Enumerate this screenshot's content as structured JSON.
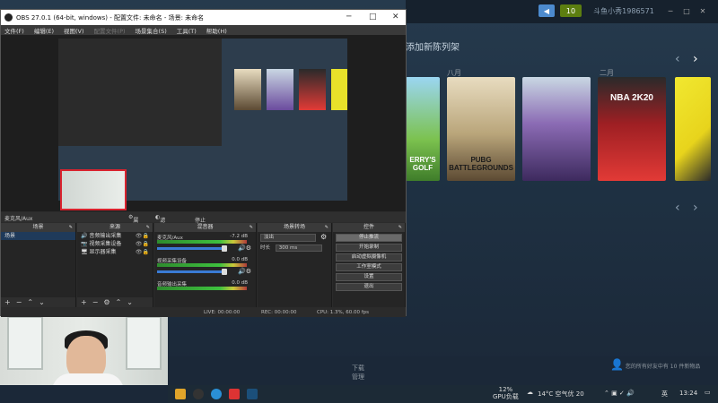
{
  "obs": {
    "title": "OBS 27.0.1 (64-bit, windows) - 配置文件: 未命名 - 场景: 未命名",
    "menu": [
      "文件(F)",
      "编辑(E)",
      "视图(V)",
      "配置文件(P)",
      "场景集合(S)",
      "工具(T)",
      "帮助(H)"
    ],
    "toolbar": {
      "source_label": "麦克风/Aux",
      "properties": "属性",
      "filters": "滤镜",
      "deactivate": "停止激活"
    },
    "docks": {
      "scenes": {
        "title": "场景",
        "items": [
          "场景"
        ]
      },
      "sources": {
        "title": "来源",
        "items": [
          "音频输出采集",
          "视频采集设备",
          "显示器采集"
        ]
      },
      "mixer": {
        "title": "混音器",
        "channels": [
          {
            "name": "麦克风/Aux",
            "db": "-7.2 dB",
            "level": 0.7
          },
          {
            "name": "视频采集设备",
            "db": "0.0 dB",
            "level": 0.7
          },
          {
            "name": "音频输出采集",
            "db": "0.0 dB",
            "level": 0.7
          }
        ]
      },
      "transitions": {
        "title": "场景转场",
        "type": "淡出",
        "duration_label": "时长",
        "duration": "300 ms"
      },
      "controls": {
        "title": "控件",
        "buttons": [
          "停止推流",
          "开始录制",
          "启动虚拟摄像机",
          "工作室模式",
          "设置",
          "退出"
        ]
      }
    },
    "status": {
      "live": "LIVE: 00:00:00",
      "rec": "REC: 00:00:00",
      "cpu": "CPU: 1.3%, 60.00 fps"
    },
    "pinned_icons": [
      "gear-icon",
      "lock-icon",
      "eye-icon"
    ]
  },
  "steam": {
    "title": "添加新陈列架",
    "months": [
      "八月",
      "二月"
    ],
    "games": [
      {
        "name": "ERRY'S GOLF",
        "color": "#6db33f"
      },
      {
        "name": "PUBG BATTLEGROUNDS",
        "color": "#d7c9a2"
      },
      {
        "name": "",
        "color": "#6b4b9e"
      },
      {
        "name": "NBA 2K20",
        "color": "#c0272d"
      },
      {
        "name": "",
        "color": "#e8e22a"
      }
    ],
    "topbar": {
      "badge": "10",
      "user": "斗鱼小秀1986571"
    },
    "bottom": {
      "download": "下载",
      "manage": "管理"
    },
    "friends_text": "您的所有好友中有 10 件新物品"
  },
  "taskbar": {
    "gpu": "12%",
    "gpu_label": "GPU负载",
    "weather": "14°C 空气优 20",
    "lang": "英",
    "time": "13:24"
  },
  "colors": {
    "obs_bg": "#2b2b2b",
    "steam_bg": "#1b2838",
    "accent": "#3a7bd5"
  }
}
